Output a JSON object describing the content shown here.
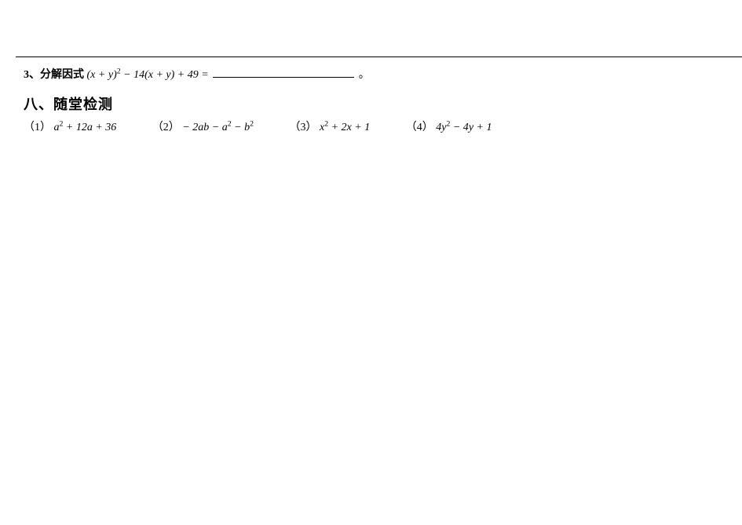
{
  "problem3": {
    "number": "3",
    "sep": "、",
    "label": "分解因式",
    "expr_html": "(<var>x</var> + <var>y</var>)<span class='sup'>2</span> − 14(<var>x</var> + <var>y</var>) + 49 =",
    "tail": "。"
  },
  "section8": {
    "heading": "八、随堂检测",
    "items": [
      {
        "label": "（1）",
        "expr_html": "<var>a</var><span class='sup'>2</span> + 12<var>a</var> + 36"
      },
      {
        "label": "（2）",
        "expr_html": "− 2<var>ab</var> − <var>a</var><span class='sup'>2</span> − <var>b</var><span class='sup'>2</span>"
      },
      {
        "label": "（3）",
        "expr_html": "<var>x</var><span class='sup'>2</span> + 2<var>x</var> + 1"
      },
      {
        "label": "（4）",
        "expr_html": "4<var>y</var><span class='sup'>2</span> − 4<var>y</var> + 1"
      }
    ]
  }
}
